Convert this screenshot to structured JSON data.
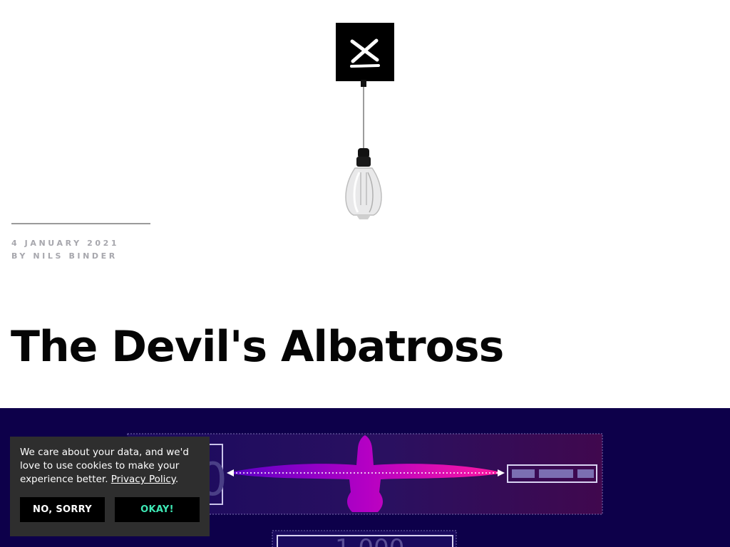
{
  "header": {
    "logo_icon": "x-mark-logo-icon",
    "lamp_icon": "hanging-lightbulb-icon"
  },
  "article": {
    "date": "4 JANUARY 2021",
    "byline": "BY NILS BINDER",
    "title": "The Devil's Albatross"
  },
  "hero": {
    "illustration": "albatross-wingspan-diagram",
    "bird_colors": [
      "#5a00c8",
      "#ff1aa0"
    ],
    "background_color": "#0d004a"
  },
  "cookie_banner": {
    "message": "We care about your data, and we'd love to use cookies to make your experience better.",
    "policy_link": "Privacy Policy",
    "trailing": ".",
    "decline_label": "NO, SORRY",
    "accept_label": "OKAY!",
    "accept_color": "#3ee8b5"
  }
}
